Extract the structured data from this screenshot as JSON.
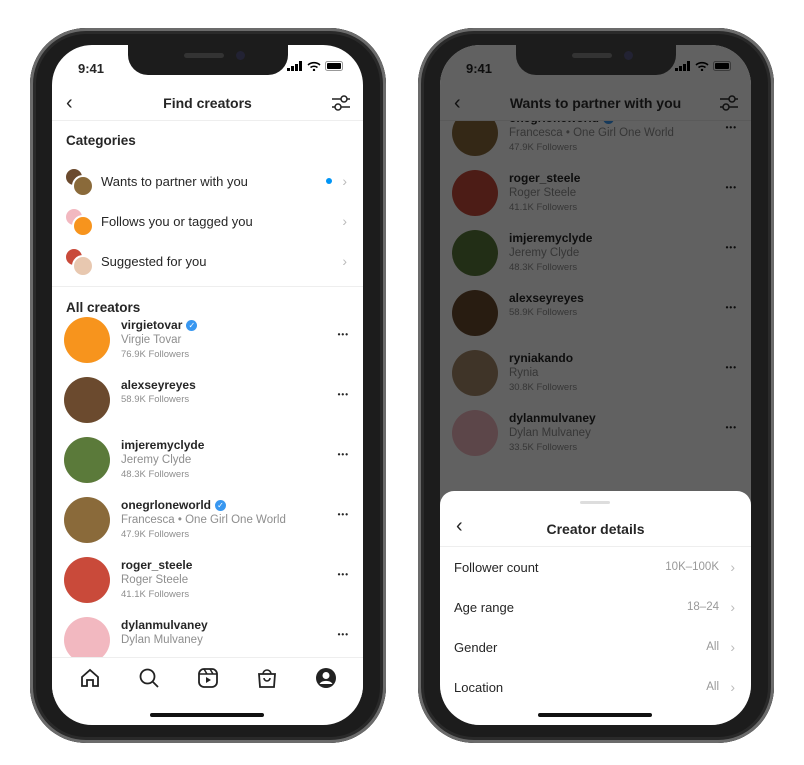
{
  "status": {
    "time": "9:41"
  },
  "left": {
    "title": "Find creators",
    "categories_heading": "Categories",
    "categories": [
      {
        "label": "Wants to partner with you",
        "unread": true
      },
      {
        "label": "Follows you or tagged you",
        "unread": false
      },
      {
        "label": "Suggested for you",
        "unread": false
      }
    ],
    "all_heading": "All creators",
    "creators": [
      {
        "username": "virgietovar",
        "verified": true,
        "name": "Virgie Tovar",
        "followers": "76.9K Followers",
        "color": "#f7941d"
      },
      {
        "username": "alexseyreyes",
        "verified": false,
        "name": "",
        "followers": "58.9K Followers",
        "color": "#6b4a2e"
      },
      {
        "username": "imjeremyclyde",
        "verified": false,
        "name": "Jeremy Clyde",
        "followers": "48.3K Followers",
        "color": "#5b7a3a"
      },
      {
        "username": "onegrloneworld",
        "verified": true,
        "name": "Francesca • One Girl One World",
        "followers": "47.9K Followers",
        "color": "#8a6a3a"
      },
      {
        "username": "roger_steele",
        "verified": false,
        "name": "Roger Steele",
        "followers": "41.1K Followers",
        "color": "#c94a3a"
      },
      {
        "username": "dylanmulvaney",
        "verified": false,
        "name": "Dylan Mulvaney",
        "followers": "",
        "color": "#f2b8c0"
      }
    ],
    "tabs": [
      "home-icon",
      "search-icon",
      "reels-icon",
      "shop-icon",
      "profile-icon"
    ]
  },
  "right": {
    "title": "Wants to partner with you",
    "creators": [
      {
        "username": "onegrloneworld",
        "verified": true,
        "name": "Francesca • One Girl One World",
        "followers": "47.9K Followers",
        "color": "#8a6a3a"
      },
      {
        "username": "roger_steele",
        "verified": false,
        "name": "Roger Steele",
        "followers": "41.1K Followers",
        "color": "#c94a3a"
      },
      {
        "username": "imjeremyclyde",
        "verified": false,
        "name": "Jeremy Clyde",
        "followers": "48.3K Followers",
        "color": "#5b7a3a"
      },
      {
        "username": "alexseyreyes",
        "verified": false,
        "name": "",
        "followers": "58.9K Followers",
        "color": "#6b4a2e"
      },
      {
        "username": "ryniakando",
        "verified": false,
        "name": "Rynia",
        "followers": "30.8K Followers",
        "color": "#a58a6a"
      },
      {
        "username": "dylanmulvaney",
        "verified": false,
        "name": "Dylan Mulvaney",
        "followers": "33.5K Followers",
        "color": "#f2b8c0"
      }
    ],
    "sheet": {
      "title": "Creator details",
      "options": [
        {
          "label": "Follower count",
          "value": "10K–100K"
        },
        {
          "label": "Age range",
          "value": "18–24"
        },
        {
          "label": "Gender",
          "value": "All"
        },
        {
          "label": "Location",
          "value": "All"
        }
      ]
    }
  },
  "colors": {
    "accent": "#0095f6",
    "verified": "#3897f0"
  }
}
